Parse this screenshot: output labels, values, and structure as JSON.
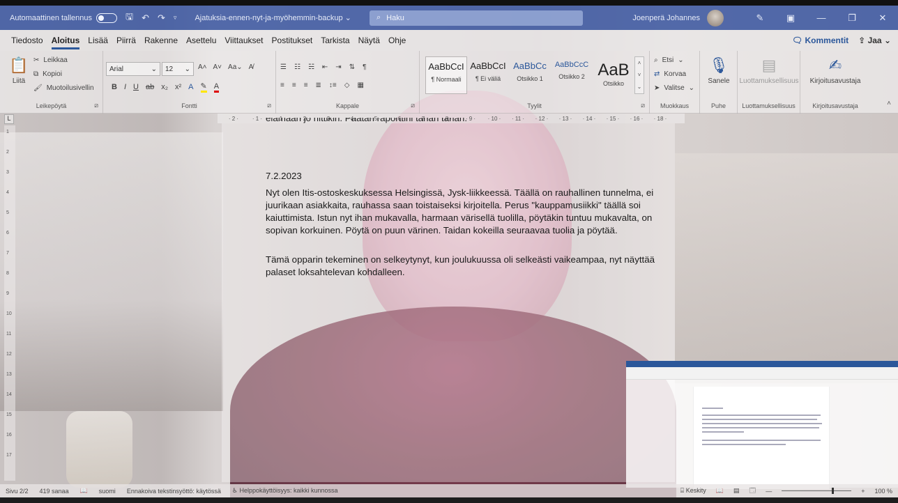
{
  "titlebar": {
    "autosave_label": "Automaattinen tallennus",
    "doc_name": "Ajatuksia-ennen-nyt-ja-myöhemmin-backup",
    "search_placeholder": "Haku",
    "user_name": "Joenperä Johannes"
  },
  "menu": {
    "tabs": [
      "Tiedosto",
      "Aloitus",
      "Lisää",
      "Piirrä",
      "Rakenne",
      "Asettelu",
      "Viittaukset",
      "Postitukset",
      "Tarkista",
      "Näytä",
      "Ohje"
    ],
    "active_tab": "Aloitus",
    "comments": "Kommentit",
    "share": "Jaa"
  },
  "ribbon": {
    "clipboard": {
      "paste": "Liitä",
      "cut": "Leikkaa",
      "copy": "Kopioi",
      "format_painter": "Muotoilusivellin",
      "label": "Leikepöytä"
    },
    "font": {
      "family": "Arial",
      "size": "12",
      "label": "Fontti"
    },
    "paragraph": {
      "label": "Kappale"
    },
    "styles": {
      "items": [
        {
          "sample": "AaBbCcI",
          "name": "¶ Normaali"
        },
        {
          "sample": "AaBbCcI",
          "name": "¶ Ei väliä"
        },
        {
          "sample": "AaBbCc",
          "name": "Otsikko 1"
        },
        {
          "sample": "AaBbCcC",
          "name": "Otsikko 2"
        },
        {
          "sample": "AaB",
          "name": "Otsikko"
        }
      ],
      "label": "Tyylit"
    },
    "editing": {
      "find": "Etsi",
      "replace": "Korvaa",
      "select": "Valitse",
      "label": "Muokkaus"
    },
    "voice": {
      "dictate": "Sanele",
      "label": "Puhe"
    },
    "sensitivity": {
      "label": "Luottamuksellisuus",
      "button": "Luottamuksellisuus"
    },
    "editor": {
      "button": "Kirjoitusavustaja",
      "label": "Kirjoitusavustaja"
    }
  },
  "ruler": {
    "h_marks": [
      "2",
      "1",
      "1",
      "2",
      "3",
      "4",
      "5",
      "6",
      "7",
      "8",
      "9",
      "10",
      "11",
      "12",
      "13",
      "14",
      "15",
      "16",
      "18"
    ],
    "v_marks": [
      "1",
      "2",
      "3",
      "4",
      "5",
      "6",
      "7",
      "8",
      "9",
      "10",
      "11",
      "12",
      "13",
      "14",
      "15",
      "16",
      "17"
    ],
    "corner": "L"
  },
  "document": {
    "cut_line": "elämään jo riittikin. Päätän raporttini tähän tähän.",
    "date": "7.2.2023",
    "paragraph1": "Nyt olen Itis-ostoskeskuksessa Helsingissä, Jysk-liikkeessä. Täällä on rauhallinen tunnelma, ei juurikaan asiakkaita, rauhassa saan toistaiseksi kirjoitella. Perus \"kauppamusiikki\" täällä soi kaiuttimista. Istun nyt ihan mukavalla, harmaan värisellä tuolilla, pöytäkin tuntuu mukavalta, on sopivan korkuinen. Pöytä on puun värinen. Taidan kokeilla seuraavaa tuolia ja pöytää.",
    "paragraph2": "Tämä opparin tekeminen on selkeytynyt, kun joulukuussa oli selkeästi vaikeampaa, nyt näyttää palaset loksahtelevan kohdalleen."
  },
  "status": {
    "page": "Sivu 2/2",
    "words": "419 sanaa",
    "language": "suomi",
    "predictive": "Ennakoiva tekstinsyöttö: käytössä",
    "accessibility": "Helppokäyttöisyys: kaikki kunnossa",
    "focus": "Keskity",
    "zoom": "100 %",
    "zoom_fraction": 0.72
  },
  "colors": {
    "accent": "#2b579a",
    "titlebar": "#3452a0"
  }
}
